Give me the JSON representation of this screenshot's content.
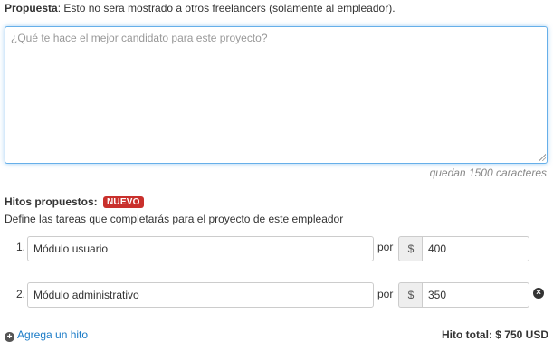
{
  "proposal": {
    "label": "Propuesta",
    "note": ": Esto no sera mostrado a otros freelancers (solamente al empleador).",
    "placeholder": "¿Qué te hace el mejor candidato para este proyecto?",
    "value": "",
    "chars_left": "quedan 1500 caracteres"
  },
  "milestones": {
    "title": "Hitos propuestos:",
    "badge": "NUEVO",
    "description": "Define las tareas que completarás para el proyecto de este empleador",
    "por_label": "por",
    "currency_symbol": "$",
    "items": [
      {
        "number": "1.",
        "task": "Módulo usuario",
        "amount": "400",
        "removable": false
      },
      {
        "number": "2.",
        "task": "Módulo administrativo",
        "amount": "350",
        "removable": true
      }
    ],
    "add_label": "Agrega un hito",
    "total_label": "Hito total:",
    "total_value": "$ 750 USD"
  },
  "icons": {
    "add": "plus-circle-icon",
    "remove": "times-circle-icon"
  },
  "colors": {
    "focus_border": "#66afe9",
    "badge_bg": "#c9302c",
    "link": "#1a7bc7"
  }
}
